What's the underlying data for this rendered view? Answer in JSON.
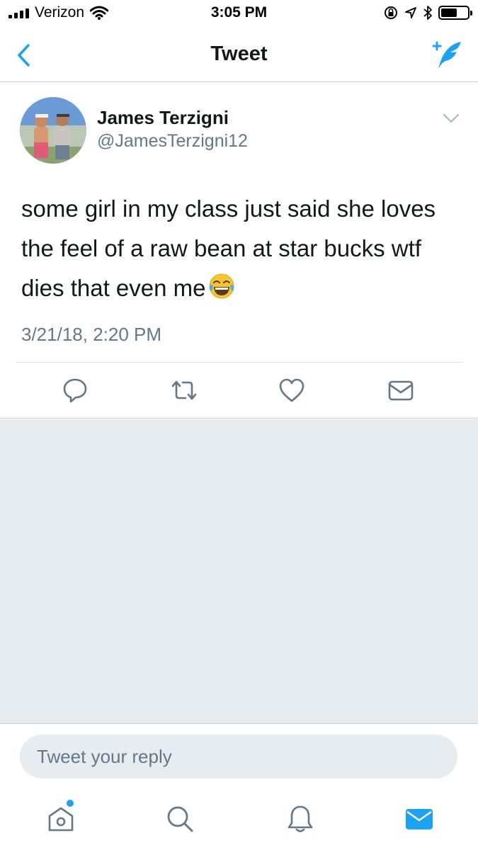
{
  "status_bar": {
    "carrier": "Verizon",
    "time": "3:05 PM",
    "icons": [
      "signal-icon",
      "wifi-icon",
      "rotation-lock-icon",
      "location-icon",
      "bluetooth-icon",
      "battery-icon"
    ],
    "battery_level": 0.6
  },
  "nav": {
    "title": "Tweet",
    "back_icon": "chevron-left-icon",
    "compose_icon": "compose-tweet-icon"
  },
  "tweet": {
    "display_name": "James Terzigni",
    "handle": "@JamesTerzigni12",
    "text": "some girl in my class just said she loves the feel of a raw bean at star bucks wtf dies that even me",
    "emoji": "tears-of-joy-emoji",
    "timestamp": "3/21/18, 2:20 PM",
    "actions": [
      "reply-icon",
      "retweet-icon",
      "like-icon",
      "direct-message-icon"
    ]
  },
  "reply": {
    "placeholder": "Tweet your reply"
  },
  "tab_bar": {
    "tabs": [
      "home-icon",
      "search-icon",
      "notifications-icon",
      "messages-icon"
    ],
    "active": "messages-icon"
  },
  "colors": {
    "accent": "#1da1f2",
    "text_primary": "#14171a",
    "text_secondary": "#657786",
    "background_grey": "#e6ecf0",
    "divider": "#c8cdd2"
  }
}
